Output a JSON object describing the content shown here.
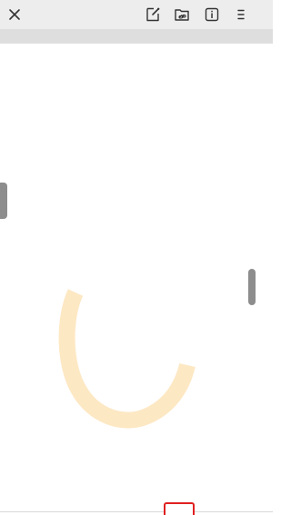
{
  "toolbar": {
    "buttons": [
      {
        "name": "close-icon"
      },
      {
        "name": "edit-note-icon"
      },
      {
        "name": "folder-link-icon"
      },
      {
        "name": "info-icon"
      },
      {
        "name": "menu-icon"
      }
    ]
  },
  "content": {
    "loading_indicator": {
      "state": "loading"
    }
  },
  "colors": {
    "toolbar_bg": "#ededed",
    "subbar_bg": "#dedede",
    "spinner": "#fde8c4",
    "handle": "#8d8d8d",
    "highlight": "#e02020"
  }
}
